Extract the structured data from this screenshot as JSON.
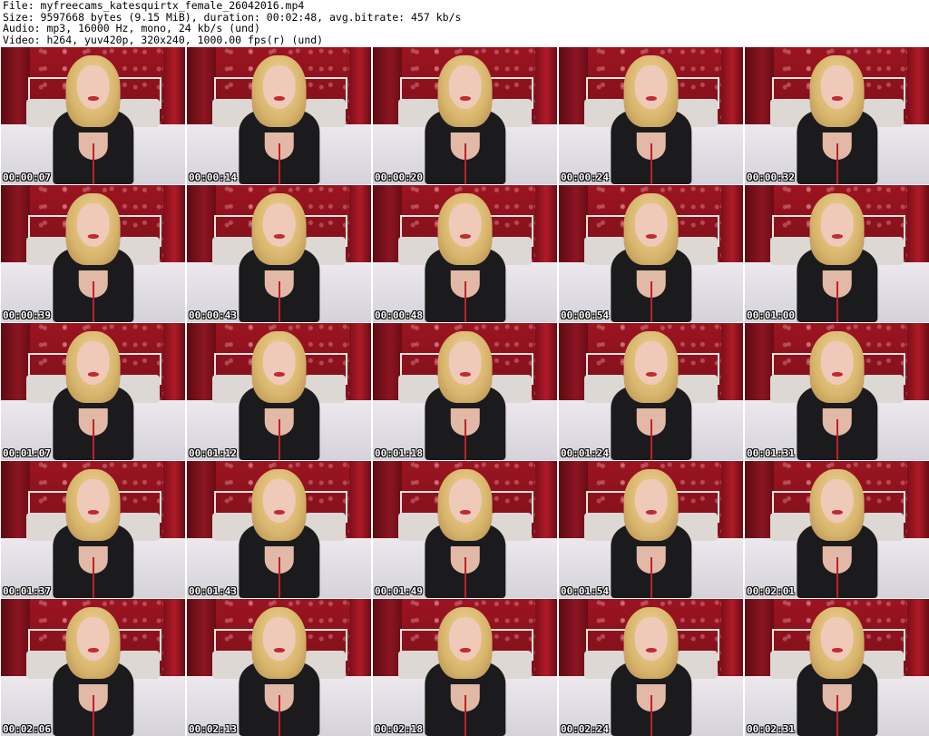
{
  "header": {
    "file_line": "File: myfreecams_katesquirtx_female_26042016.mp4",
    "size_line": "Size: 9597668 bytes (9.15 MiB), duration: 00:02:48, avg.bitrate: 457 kb/s",
    "audio_line": "Audio: mp3, 16000 Hz, mono, 24 kb/s (und)",
    "video_line": "Video: h264, yuv420p, 320x240, 1000.00 fps(r) (und)"
  },
  "thumbnails": [
    {
      "timestamp": "00:00:07"
    },
    {
      "timestamp": "00:00:14"
    },
    {
      "timestamp": "00:00:20"
    },
    {
      "timestamp": "00:00:24"
    },
    {
      "timestamp": "00:00:32"
    },
    {
      "timestamp": "00:00:39"
    },
    {
      "timestamp": "00:00:43"
    },
    {
      "timestamp": "00:00:48"
    },
    {
      "timestamp": "00:00:54"
    },
    {
      "timestamp": "00:01:00"
    },
    {
      "timestamp": "00:01:07"
    },
    {
      "timestamp": "00:01:12"
    },
    {
      "timestamp": "00:01:18"
    },
    {
      "timestamp": "00:01:24"
    },
    {
      "timestamp": "00:01:31"
    },
    {
      "timestamp": "00:01:37"
    },
    {
      "timestamp": "00:01:43"
    },
    {
      "timestamp": "00:01:49"
    },
    {
      "timestamp": "00:01:54"
    },
    {
      "timestamp": "00:02:01"
    },
    {
      "timestamp": "00:02:06"
    },
    {
      "timestamp": "00:02:13"
    },
    {
      "timestamp": "00:02:18"
    },
    {
      "timestamp": "00:02:24"
    },
    {
      "timestamp": "00:02:31"
    }
  ]
}
